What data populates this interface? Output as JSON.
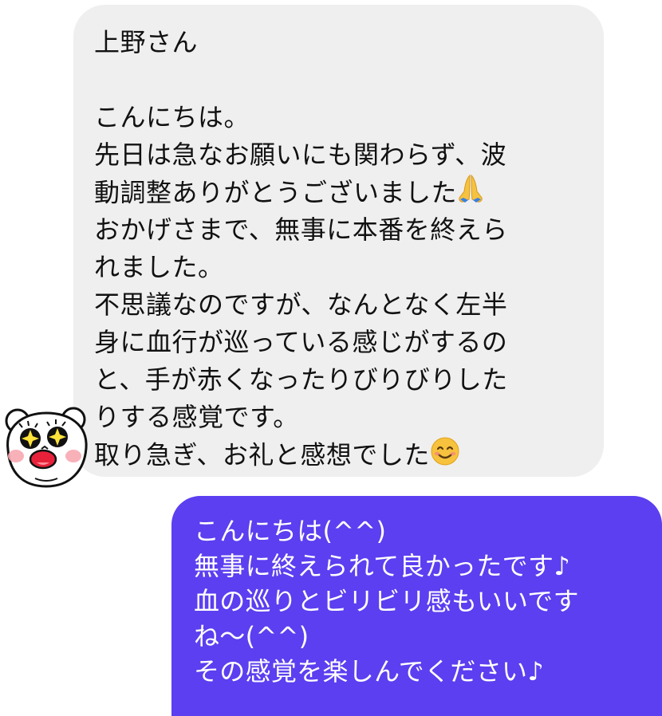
{
  "incoming_message": {
    "lines": [
      "上野さん",
      "",
      "こんにちは。",
      "先日は急なお願いにも関わらず、波",
      "動調整ありがとうございました",
      "おかげさまで、無事に本番を終えら",
      "れました。",
      "不思議なのですが、なんとなく左半",
      "身に血行が巡っている感じがするの",
      "と、手が赤くなったりびりびりした",
      "りする感覚です。",
      "取り急ぎ、お礼と感想でした"
    ],
    "emoji_after_line_4": "folded-hands-emoji",
    "emoji_after_line_11": "smiling-face-emoji"
  },
  "outgoing_message": {
    "lines": [
      "こんにちは(^^)",
      "無事に終えられて良かったです♪",
      "血の巡りとビリビリ感もいいです",
      "ね〜(^^)",
      "その感覚を楽しんでください♪"
    ]
  },
  "colors": {
    "incoming_bubble": "#efefef",
    "outgoing_bubble": "#5b3ff0",
    "outgoing_text": "#ffffff"
  },
  "avatar": {
    "icon": "bear-sticker-avatar"
  }
}
